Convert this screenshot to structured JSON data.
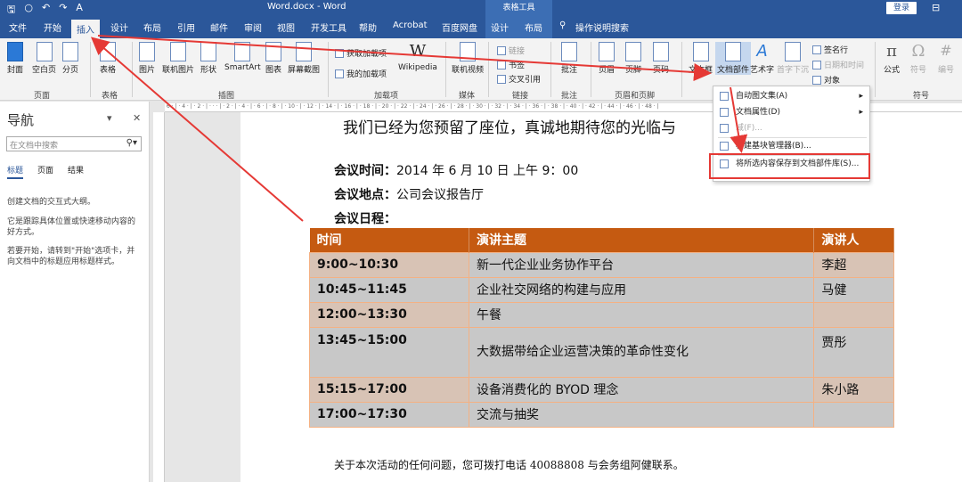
{
  "titlebar": {
    "title": "Word.docx - Word",
    "context_tools": "表格工具",
    "login": "登录",
    "qat_icons": [
      "save-icon",
      "autosave-icon",
      "undo-icon",
      "redo-icon",
      "font-color-icon"
    ]
  },
  "tabs": [
    "文件",
    "开始",
    "插入",
    "设计",
    "布局",
    "引用",
    "邮件",
    "审阅",
    "视图",
    "开发工具",
    "帮助",
    "Acrobat",
    "百度网盘",
    "设计",
    "布局"
  ],
  "active_tab": "插入",
  "tell_me": "操作说明搜索",
  "ribbon": {
    "pages": [
      "封面",
      "空白页",
      "分页"
    ],
    "pages_group": "页面",
    "table": "表格",
    "table_group": "表格",
    "illustrations": [
      "图片",
      "联机图片",
      "形状",
      "SmartArt",
      "图表",
      "屏幕截图"
    ],
    "illustrations_group": "插图",
    "addins": [
      "获取加载项",
      "我的加载项"
    ],
    "wikipedia": "Wikipedia",
    "addins_group": "加载项",
    "media": "联机视频",
    "media_group": "媒体",
    "links": [
      "链接",
      "书签",
      "交叉引用"
    ],
    "links_group": "链接",
    "comment": "批注",
    "comment_group": "批注",
    "header_footer": [
      "页眉",
      "页脚",
      "页码"
    ],
    "header_footer_group": "页眉和页脚",
    "text": [
      "文本框",
      "文档部件",
      "艺术字",
      "首字下沉"
    ],
    "signature": "签名行",
    "datetime": "日期和时间",
    "object": "对象",
    "symbols": [
      "公式",
      "符号",
      "编号"
    ],
    "symbols_group": "符号"
  },
  "nav": {
    "title": "导航",
    "search_placeholder": "在文档中搜索",
    "tabs": [
      "标题",
      "页面",
      "结果"
    ],
    "text1": "创建文档的交互式大纲。",
    "text2": "它是跟踪具体位置或快速移动内容的好方式。",
    "text3": "若要开始，请转到\"开始\"选项卡，并向文档中的标题应用标题样式。"
  },
  "document": {
    "heading": "我们已经为您预留了座位，真诚地期待您的光临与",
    "meeting_time_label": "会议时间：",
    "meeting_time": "2014 年 6 月 10 日 上午 9：00",
    "meeting_place_label": "会议地点：",
    "meeting_place": "公司会议报告厅",
    "meeting_agenda_label": "会议日程：",
    "table_headers": [
      "时间",
      "演讲主题",
      "演讲人"
    ],
    "rows": [
      {
        "time": "9:00~10:30",
        "topic": "新一代企业业务协作平台",
        "speaker": "李超"
      },
      {
        "time": "10:45~11:45",
        "topic": "企业社交网络的构建与应用",
        "speaker": "马健"
      },
      {
        "time": "12:00~13:30",
        "topic": "午餐",
        "speaker": ""
      },
      {
        "time": "13:45~15:00",
        "topic": "大数据带给企业运营决策的革命性变化",
        "speaker": "贾彤"
      },
      {
        "time": "15:15~17:00",
        "topic": "设备消费化的 BYOD 理念",
        "speaker": "朱小路"
      },
      {
        "time": "17:00~17:30",
        "topic": "交流与抽奖",
        "speaker": ""
      }
    ],
    "footer": "关于本次活动的任何问题，您可拨打电话 40088808 与会务组阿健联系。"
  },
  "menu": {
    "items": [
      "自动图文集(A)",
      "文档属性(D)",
      "域(F)...",
      "构建基块管理器(B)...",
      "将所选内容保存到文档部件库(S)..."
    ]
  },
  "colors": {
    "brand": "#2b579a",
    "table_header": "#c55a11",
    "annotation": "#e53935"
  }
}
